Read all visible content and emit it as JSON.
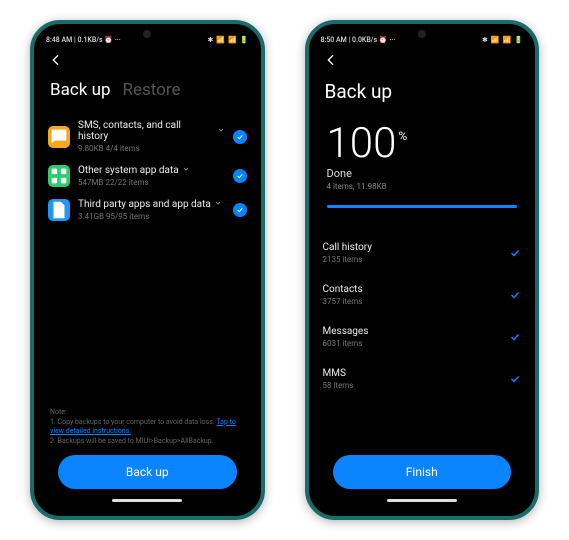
{
  "left": {
    "status": {
      "time": "8:48 AM",
      "speed": "0.1KB/s"
    },
    "tabs": {
      "active": "Back up",
      "inactive": "Restore"
    },
    "cats": [
      {
        "title": "SMS, contacts, and call history",
        "sub": "9.80KB  4/4 items"
      },
      {
        "title": "Other system app data",
        "sub": "547MB  22/22 items"
      },
      {
        "title": "Third party apps and app data",
        "sub": "3.41GB  95/95 items"
      }
    ],
    "note": {
      "heading": "Note:",
      "line1a": "1. Copy backups to your computer to avoid data loss. ",
      "line1b": "Tap to view detailed instructions.",
      "line2": "2. Backups will be saved to MIUI>Backup>AllBackup."
    },
    "button": "Back up"
  },
  "right": {
    "status": {
      "time": "8:50 AM",
      "speed": "0.0KB/s"
    },
    "title": "Back up",
    "percent": "100",
    "percent_sym": "%",
    "done": "Done",
    "done_sub": "4 items, 11.98KB",
    "results": [
      {
        "title": "Call history",
        "sub": "2135 items"
      },
      {
        "title": "Contacts",
        "sub": "3757 items"
      },
      {
        "title": "Messages",
        "sub": "6031 items"
      },
      {
        "title": "MMS",
        "sub": "58 items"
      }
    ],
    "button": "Finish"
  }
}
